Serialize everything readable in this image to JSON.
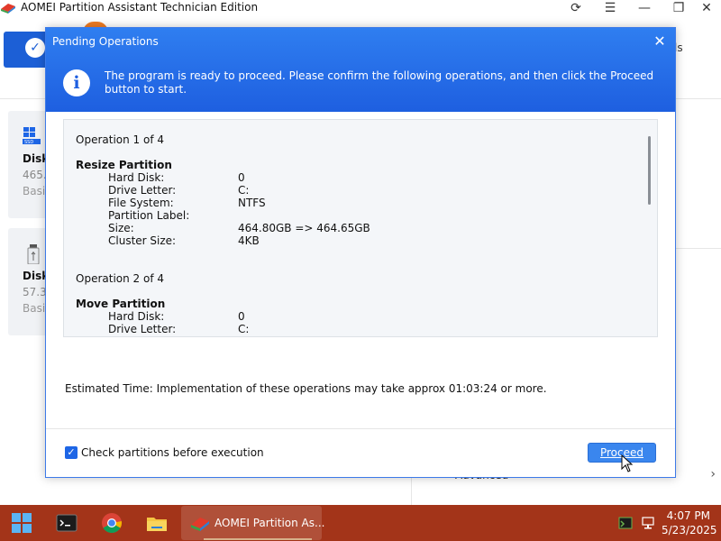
{
  "app": {
    "title": "AOMEI Partition Assistant Technician Edition",
    "toolbar_tools_label": "ls",
    "disks": [
      {
        "name": "Disk",
        "size": "465.",
        "type": "Basic"
      },
      {
        "name": "Disk",
        "size": "57.3",
        "type": "Basic"
      }
    ],
    "right_panel_advanced": "Advanced"
  },
  "modal": {
    "title": "Pending Operations",
    "info_text": "The program is ready to proceed. Please confirm the following operations, and then click the Proceed button to start.",
    "operations": [
      {
        "header": "Operation 1 of 4",
        "title": "Resize Partition",
        "rows": [
          {
            "key": "Hard Disk:",
            "value": "0"
          },
          {
            "key": "Drive Letter:",
            "value": "C:"
          },
          {
            "key": "File System:",
            "value": "NTFS"
          },
          {
            "key": "Partition Label:",
            "value": ""
          },
          {
            "key": "Size:",
            "value": "464.80GB => 464.65GB"
          },
          {
            "key": "Cluster Size:",
            "value": "4KB"
          }
        ]
      },
      {
        "header": "Operation 2 of 4",
        "title": "Move Partition",
        "rows": [
          {
            "key": "Hard Disk:",
            "value": "0"
          },
          {
            "key": "Drive Letter:",
            "value": "C:"
          }
        ]
      }
    ],
    "estimated_time": "Estimated Time: Implementation of these operations may take approx 01:03:24 or more.",
    "check_label": "Check partitions before execution",
    "check_checked": true,
    "proceed_label": "Proceed"
  },
  "taskbar": {
    "active_app_label": "AOMEI Partition As...",
    "time": "4:07 PM",
    "date": "5/23/2025"
  },
  "colors": {
    "accent": "#1e5fe0",
    "taskbar": "#a33419"
  }
}
